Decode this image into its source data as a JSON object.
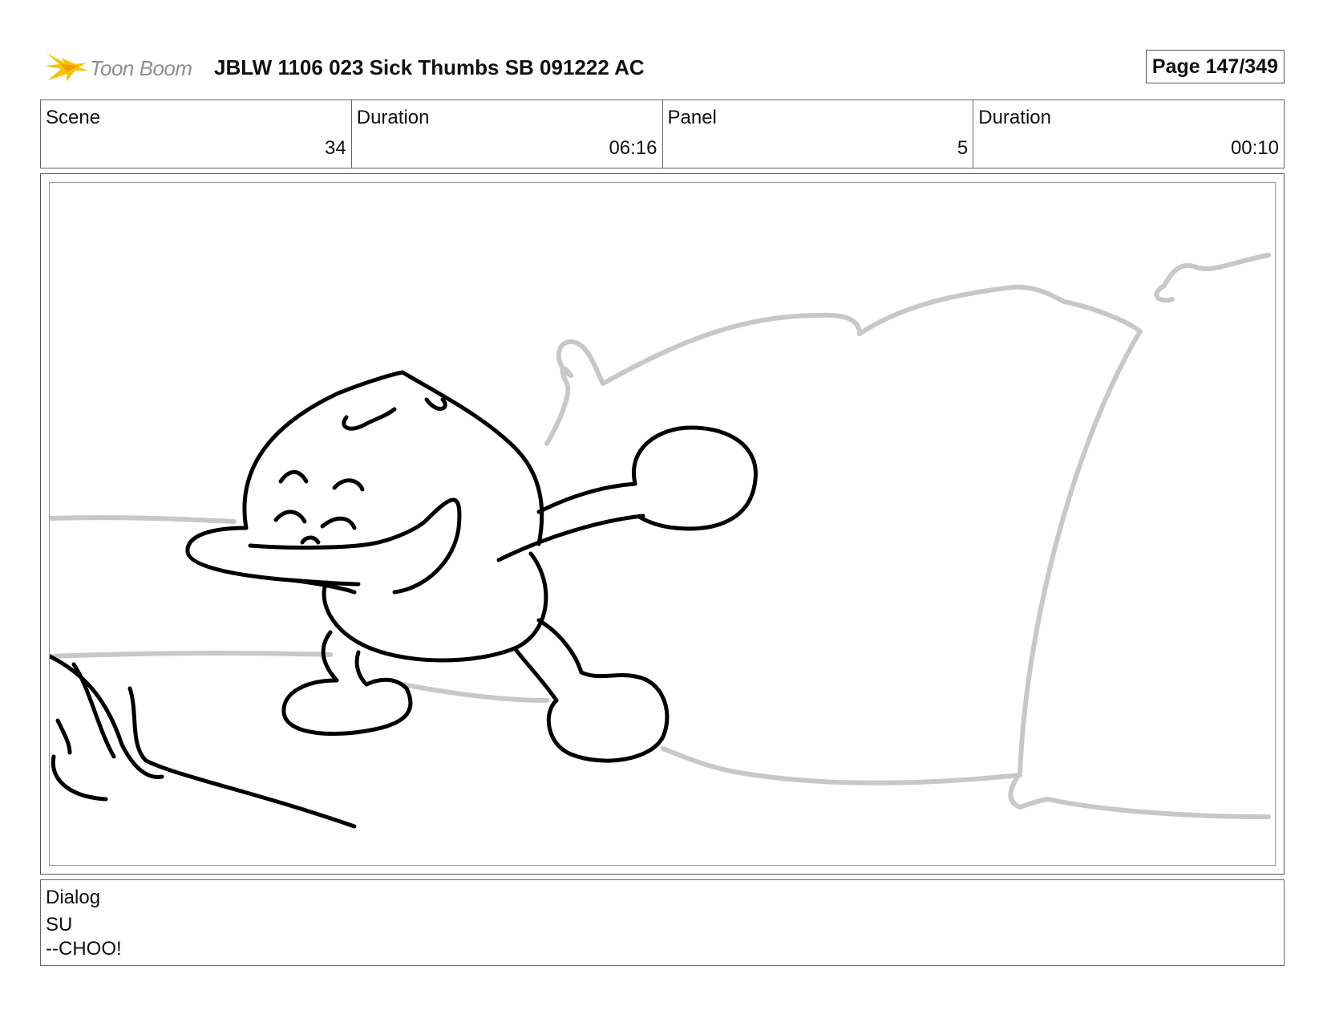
{
  "header": {
    "logo_text": "Toon Boom",
    "title": "JBLW 1106 023 Sick Thumbs SB 091222 AC",
    "page": "Page 147/349"
  },
  "info": {
    "scene_label": "Scene",
    "scene_value": "34",
    "scene_duration_label": "Duration",
    "scene_duration_value": "06:16",
    "panel_label": "Panel",
    "panel_value": "5",
    "panel_duration_label": "Duration",
    "panel_duration_value": "00:10"
  },
  "dialog": {
    "label": "Dialog",
    "character": "SU",
    "line": "--CHOO!"
  },
  "colors": {
    "logo_accent": "#f5c400",
    "sketch_ink": "#000000",
    "background_sketch": "#c8c8c8"
  }
}
